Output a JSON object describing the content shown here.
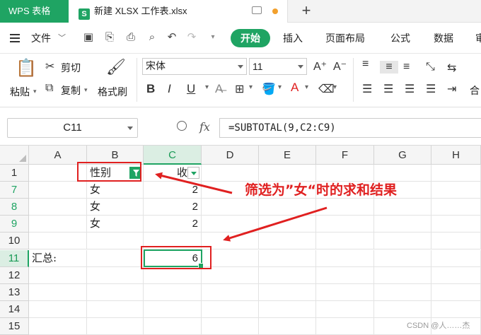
{
  "titlebar": {
    "app_tab": "WPS 表格",
    "doc_tab": "新建 XLSX 工作表.xlsx",
    "doc_icon": "S",
    "accent": "#1fa463"
  },
  "menubar": {
    "file": "文件",
    "start": "开始",
    "items": [
      "插入",
      "页面布局",
      "公式",
      "数据",
      "审"
    ]
  },
  "ribbon": {
    "paste": "粘贴",
    "cut": "剪切",
    "copy": "复制",
    "format_painter": "格式刷",
    "font_name": "宋体",
    "font_size": "11",
    "merge": "合"
  },
  "formula_bar": {
    "name_box": "C11",
    "fx": "fx",
    "formula": "=SUBTOTAL(9,C2:C9)"
  },
  "sheet": {
    "columns": [
      "A",
      "B",
      "C",
      "D",
      "E",
      "F",
      "G",
      "H"
    ],
    "rows": [
      {
        "num": "1",
        "A": "",
        "B": "性别",
        "C": "收入"
      },
      {
        "num": "7",
        "A": "",
        "B": "女",
        "C": "2"
      },
      {
        "num": "8",
        "A": "",
        "B": "女",
        "C": "2"
      },
      {
        "num": "9",
        "A": "",
        "B": "女",
        "C": "2"
      },
      {
        "num": "10",
        "A": "",
        "B": "",
        "C": ""
      },
      {
        "num": "11",
        "A": "汇总:",
        "B": "",
        "C": "6"
      },
      {
        "num": "12",
        "A": "",
        "B": "",
        "C": ""
      },
      {
        "num": "13",
        "A": "",
        "B": "",
        "C": ""
      },
      {
        "num": "14",
        "A": "",
        "B": "",
        "C": ""
      },
      {
        "num": "15",
        "A": "",
        "B": "",
        "C": ""
      }
    ]
  },
  "annotation": {
    "text": "筛选为”女“时的求和结果",
    "color": "#e02020"
  },
  "watermark": "CSDN @人……杰"
}
